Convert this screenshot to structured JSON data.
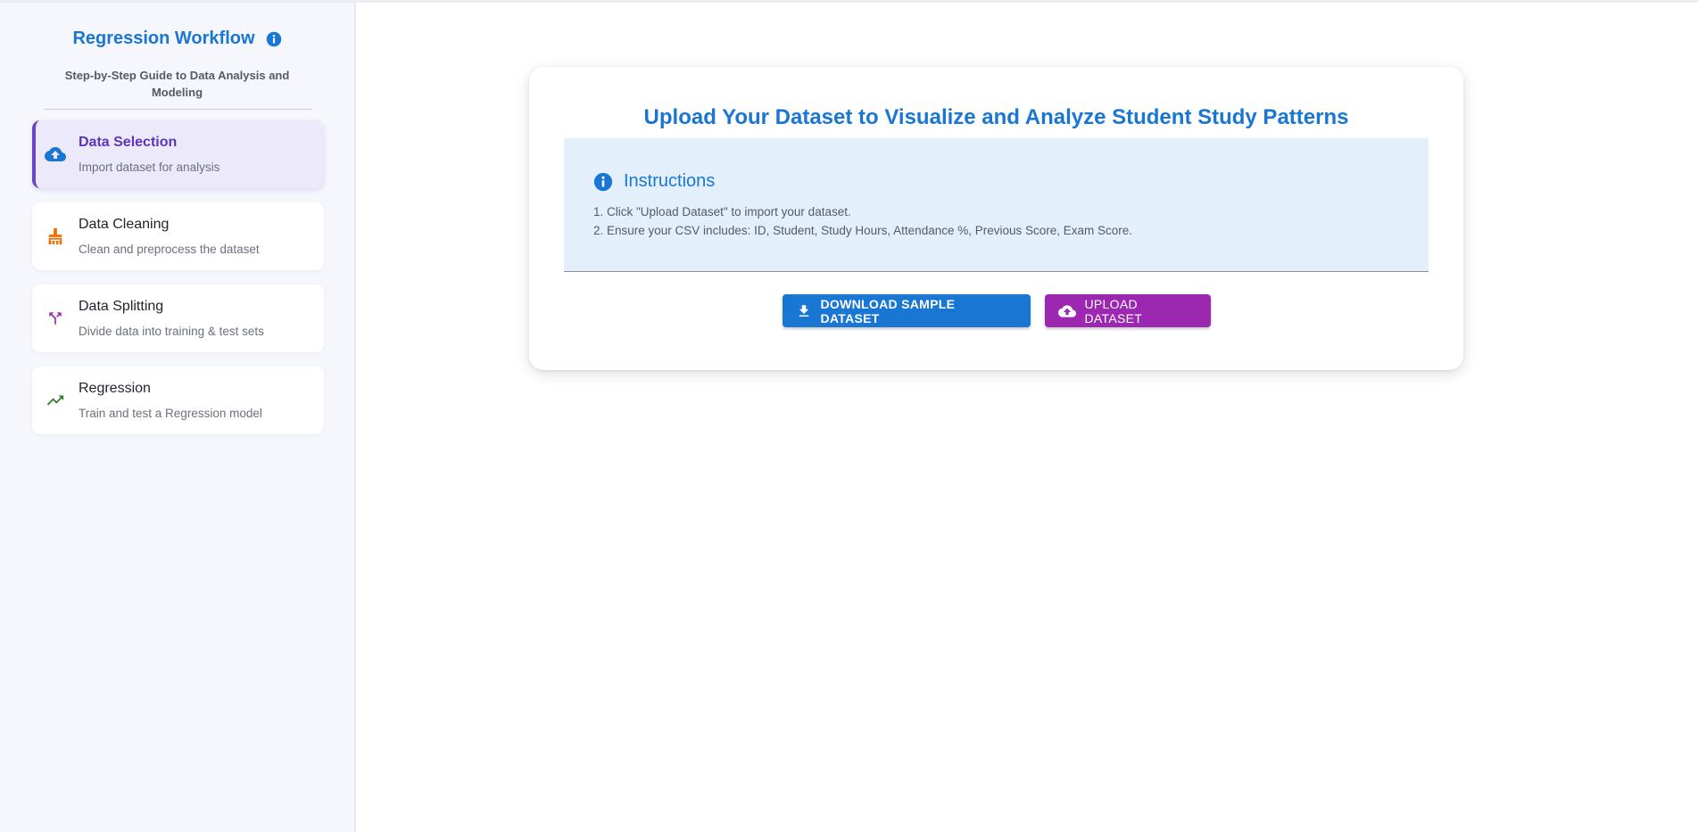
{
  "sidebar": {
    "title": "Regression Workflow",
    "subtitle": "Step-by-Step Guide to Data Analysis and Modeling",
    "steps": [
      {
        "title": "Data Selection",
        "description": "Import dataset for analysis",
        "icon": "cloud-upload-icon",
        "active": true
      },
      {
        "title": "Data Cleaning",
        "description": "Clean and preprocess the dataset",
        "icon": "cleaning-brush-icon",
        "active": false
      },
      {
        "title": "Data Splitting",
        "description": "Divide data into training & test sets",
        "icon": "split-icon",
        "active": false
      },
      {
        "title": "Regression",
        "description": "Train and test a Regression model",
        "icon": "trending-up-icon",
        "active": false
      }
    ]
  },
  "main": {
    "title": "Upload Your Dataset to Visualize and Analyze Student Study Patterns",
    "instructions": {
      "title": "Instructions",
      "items": [
        "1. Click \"Upload Dataset\" to import your dataset.",
        "2. Ensure your CSV includes: ID, Student, Study Hours, Attendance %, Previous Score, Exam Score."
      ]
    },
    "buttons": {
      "download_label": "DOWNLOAD SAMPLE DATASET",
      "upload_label": "UPLOAD DATASET"
    }
  },
  "colors": {
    "primary": "#1976d2",
    "secondary": "#9c27b0",
    "active_step": "#6d43c4",
    "cleaning_icon": "#ef6c00",
    "splitting_icon": "#9c27b0",
    "regression_icon": "#2e7d32"
  }
}
